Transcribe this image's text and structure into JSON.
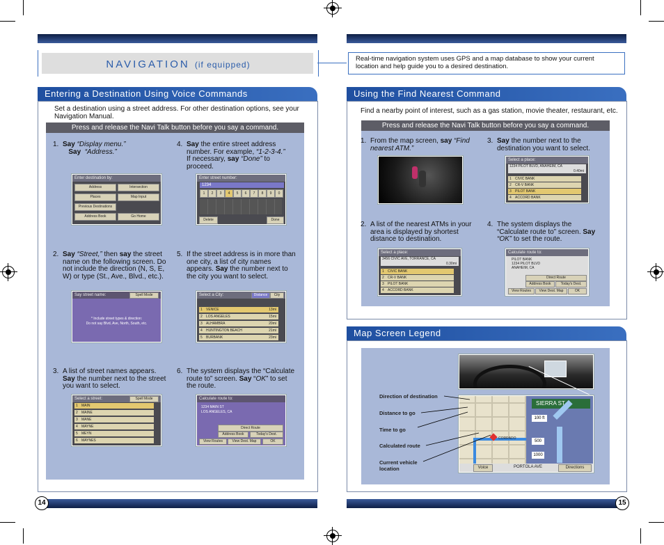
{
  "nav_title": {
    "main": "NAVIGATION",
    "suffix": "(if equipped)"
  },
  "intro_box": "Real-time navigation system uses GPS and a map database to show your current location and help guide you to a desired destination.",
  "left": {
    "heading": "Entering a Destination Using Voice Commands",
    "intro": "Set a destination using a street address. For other destination options, see your Navigation Manual.",
    "strip": "Press and release the Navi Talk button before you say a command.",
    "steps": [
      {
        "n": "1.",
        "html": "<b>Say</b> <i>“Display menu.”</i><br>&nbsp;&nbsp;&nbsp;<b>Say</b> &nbsp;<i>“Address.”</i>"
      },
      {
        "n": "4.",
        "html": "<b>Say</b> the entire street address number. For example, <i>“1-2-3-4.”</i> If necessary, <b>say</b> <i>“Done”</i> to proceed."
      },
      {
        "n": "2.",
        "html": "<b>Say</b> <i>“Street,”</i> then <b>say</b> the street name on the following screen. Do not include the direction (N, S, E, W) or type (St., Ave., Blvd., etc.)."
      },
      {
        "n": "5.",
        "html": "If the street address is in more than one city, a list of city names appears. <b>Say</b> the number next to the city you want to select."
      },
      {
        "n": "3.",
        "html": "A list of street names appears. <b>Say</b> the number next to the street you want to select."
      },
      {
        "n": "6.",
        "html": "The system displays the “Calculate route to” screen. <b>Say</b> “<i>OK</i>” to set the route."
      }
    ],
    "screens": {
      "dest": {
        "title": "Enter destination by:",
        "items": [
          "Address",
          "Intersection",
          "Places",
          "Map Input",
          "Previous Destinations",
          "",
          "Address Book",
          "Go Home"
        ]
      },
      "number": {
        "title": "Enter street number:",
        "value": "1234",
        "keys": [
          "1",
          "2",
          "3",
          "4",
          "5",
          "6",
          "7",
          "8",
          "9",
          "0"
        ],
        "delete": "Delete",
        "done": "Done"
      },
      "street_name": {
        "title": "Say street name:",
        "mode": "Spell Mode",
        "hint": "* Include street types & direction:",
        "hint2": "Do not say Blvd, Ave, North, South, etc."
      },
      "city": {
        "title": "Select a City:",
        "tabs": [
          "Distance",
          "City"
        ],
        "rows": [
          "VENICE",
          "LOS ANGELES",
          "ALHAMBRA",
          "HUNTINGTON BEACH",
          "BURBANK"
        ],
        "dists": [
          "13mi",
          "15mi",
          "20mi",
          "21mi",
          "23mi"
        ]
      },
      "street_list": {
        "title": "Select a street:",
        "mode": "Spell Mode",
        "rows": [
          "MAIN",
          "MAINE",
          "MANE",
          "MAYNE",
          "MEYN",
          "MAYNES"
        ]
      },
      "calc": {
        "title": "Calculate route to:",
        "addr1": "1234 MAIN ST",
        "addr2": "LOS ANGELES, CA",
        "route": "Direct Route",
        "b1": "Address Book",
        "b2": "Today's Dest.",
        "b3": "View Routes",
        "b4": "View Dest. Map",
        "b5": "OK"
      }
    }
  },
  "right": {
    "heading": "Using the Find Nearest Command",
    "intro": "Find a nearby point of interest, such as a gas station, movie theater, restaurant, etc.",
    "strip": "Press and release the Navi Talk button before you say a command.",
    "steps": [
      {
        "n": "1.",
        "html": "From the map screen, <b>say</b> <i>“Find nearest ATM.”</i>"
      },
      {
        "n": "3.",
        "html": "<b>Say</b> the number next to the destination you want to select."
      },
      {
        "n": "2.",
        "html": "A list of the nearest ATMs in your area is displayed by shortest distance to destination."
      },
      {
        "n": "4.",
        "html": "The system displays the “Calculate route to” screen. <b>Say</b> <i>“OK”</i> to set the route."
      }
    ],
    "screens": {
      "place3": {
        "title": "Select a place:",
        "addr": "1234 PILOT BLVD, ANAHEIM, CA",
        "dist": "0.40mi",
        "rows": [
          "CIVIC BANK",
          "CR-V BANK",
          "PILOT BANK",
          "ACCORD BANK"
        ]
      },
      "place2": {
        "title": "Select a place:",
        "addr": "3456 CIVIC AVE, TORRANCE, CA",
        "dist": "0.30mi",
        "rows": [
          "CIVIC BANK",
          "CR-V BANK",
          "PILOT BANK",
          "ACCORD BANK"
        ]
      },
      "calc": {
        "title": "Calculate route to:",
        "addr1": "PILOT BANK",
        "addr2": "1234 PILOT BLVD",
        "addr3": "ANAHEIM, CA",
        "route": "Direct Route",
        "b1": "Address Book",
        "b2": "Today's Dest.",
        "b3": "View Routes",
        "b4": "View Dest. Map",
        "b5": "OK"
      }
    }
  },
  "legend": {
    "heading": "Map Screen Legend",
    "labels": [
      "Direction of destination",
      "Distance to go",
      "Time to go",
      "Calculated route",
      "Current vehicle location"
    ],
    "map": {
      "street": "SIERRA ST",
      "d1": "100 ft",
      "d2": "500",
      "d3": "1000",
      "voice": "Voice",
      "directions": "Directions",
      "road1": "PORTOLA AVE",
      "road2": "CORRADO"
    }
  },
  "pages": {
    "left": "14",
    "right": "15"
  },
  "colors": {
    "heading_blue": "#2a5caa",
    "panel_blue": "#a9b8d8",
    "strip": "#5d5d66"
  }
}
